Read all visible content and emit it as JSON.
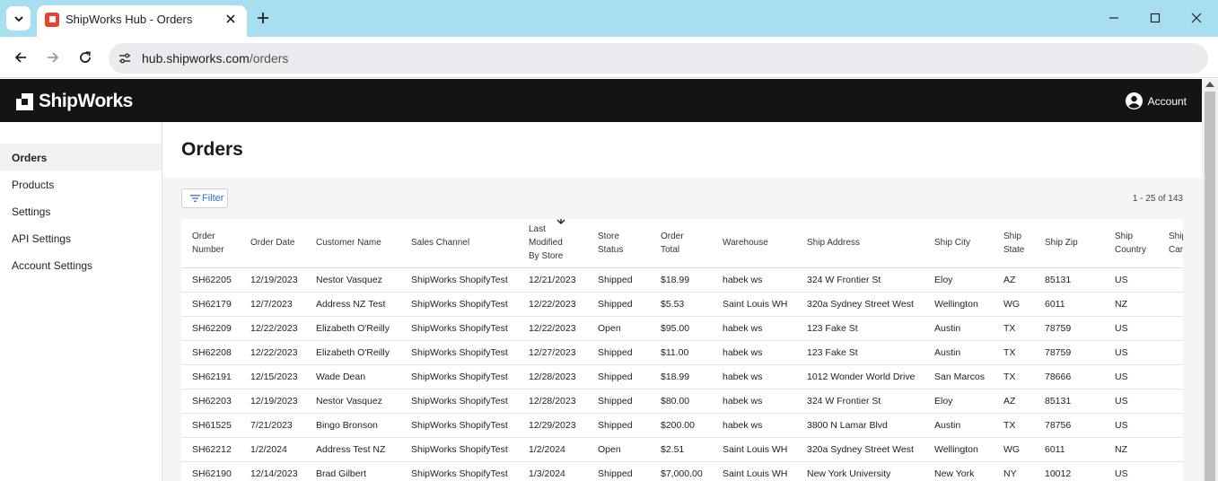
{
  "browser": {
    "tab_title": "ShipWorks Hub - Orders",
    "url_host": "hub.shipworks.com",
    "url_path": "/orders"
  },
  "header": {
    "logo_text": "ShipWorks",
    "account_label": "Account"
  },
  "sidebar": {
    "items": [
      {
        "label": "Orders",
        "active": true
      },
      {
        "label": "Products"
      },
      {
        "label": "Settings"
      },
      {
        "label": "API Settings"
      },
      {
        "label": "Account Settings"
      }
    ]
  },
  "main": {
    "title": "Orders",
    "filter_label": "Filter",
    "pager": "1 - 25 of 143"
  },
  "table": {
    "columns": [
      {
        "line1": "Order",
        "line2": "Number"
      },
      {
        "line1": "Order Date"
      },
      {
        "line1": "Customer Name"
      },
      {
        "line1": "Sales Channel"
      },
      {
        "line1": "Last",
        "line2": "Modified",
        "line3": "By Store",
        "sorted": "desc"
      },
      {
        "line1": "Store",
        "line2": "Status"
      },
      {
        "line1": "Order",
        "line2": "Total"
      },
      {
        "line1": "Warehouse"
      },
      {
        "line1": "Ship Address"
      },
      {
        "line1": "Ship City"
      },
      {
        "line1": "Ship",
        "line2": "State"
      },
      {
        "line1": "Ship Zip"
      },
      {
        "line1": "Ship",
        "line2": "Country"
      },
      {
        "line1": "Ship",
        "line2": "Carr"
      }
    ],
    "rows": [
      [
        "SH62205",
        "12/19/2023",
        "Nestor Vasquez",
        "ShipWorks ShopifyTest",
        "12/21/2023",
        "Shipped",
        "$18.99",
        "habek ws",
        "324 W Frontier St",
        "Eloy",
        "AZ",
        "85131",
        "US",
        ""
      ],
      [
        "SH62179",
        "12/7/2023",
        "Address NZ Test",
        "ShipWorks ShopifyTest",
        "12/22/2023",
        "Shipped",
        "$5.53",
        "Saint Louis WH",
        "320a Sydney Street West",
        "Wellington",
        "WG",
        "6011",
        "NZ",
        ""
      ],
      [
        "SH62209",
        "12/22/2023",
        "Elizabeth O'Reilly",
        "ShipWorks ShopifyTest",
        "12/22/2023",
        "Open",
        "$95.00",
        "habek ws",
        "123 Fake St",
        "Austin",
        "TX",
        "78759",
        "US",
        ""
      ],
      [
        "SH62208",
        "12/22/2023",
        "Elizabeth O'Reilly",
        "ShipWorks ShopifyTest",
        "12/27/2023",
        "Shipped",
        "$11.00",
        "habek ws",
        "123 Fake St",
        "Austin",
        "TX",
        "78759",
        "US",
        ""
      ],
      [
        "SH62191",
        "12/15/2023",
        "Wade Dean",
        "ShipWorks ShopifyTest",
        "12/28/2023",
        "Shipped",
        "$18.99",
        "habek ws",
        "1012 Wonder World Drive",
        "San Marcos",
        "TX",
        "78666",
        "US",
        ""
      ],
      [
        "SH62203",
        "12/19/2023",
        "Nestor Vasquez",
        "ShipWorks ShopifyTest",
        "12/28/2023",
        "Shipped",
        "$80.00",
        "habek ws",
        "324 W Frontier St",
        "Eloy",
        "AZ",
        "85131",
        "US",
        ""
      ],
      [
        "SH61525",
        "7/21/2023",
        "Bingo Bronson",
        "ShipWorks ShopifyTest",
        "12/29/2023",
        "Shipped",
        "$200.00",
        "habek ws",
        "3800 N Lamar Blvd",
        "Austin",
        "TX",
        "78756",
        "US",
        ""
      ],
      [
        "SH62212",
        "1/2/2024",
        "Address Test NZ",
        "ShipWorks ShopifyTest",
        "1/2/2024",
        "Open",
        "$2.51",
        "Saint Louis WH",
        "320a Sydney Street West",
        "Wellington",
        "WG",
        "6011",
        "NZ",
        ""
      ],
      [
        "SH62190",
        "12/14/2023",
        "Brad Gilbert",
        "ShipWorks ShopifyTest",
        "1/3/2024",
        "Shipped",
        "$7,000.00",
        "Saint Louis WH",
        "New York University",
        "New York",
        "NY",
        "10012",
        "US",
        ""
      ]
    ]
  }
}
